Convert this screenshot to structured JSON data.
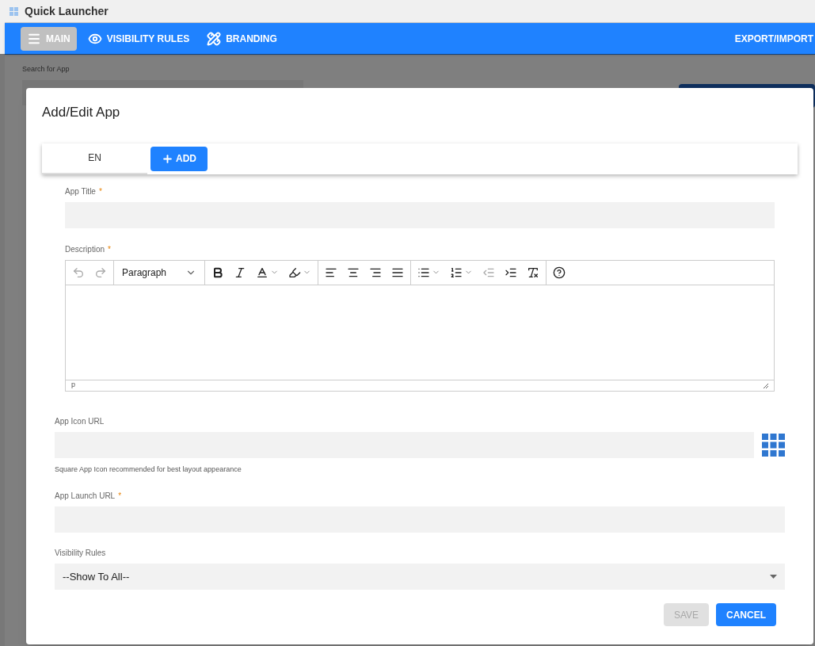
{
  "app": {
    "title": "Quick Launcher"
  },
  "nav": {
    "items": [
      {
        "label": "MAIN",
        "kind": "menu",
        "selected": true
      },
      {
        "label": "VISIBILITY RULES",
        "kind": "eye",
        "selected": false
      },
      {
        "label": "BRANDING",
        "kind": "tools",
        "selected": false
      }
    ],
    "right_label": "EXPORT/IMPORT"
  },
  "background": {
    "search_label": "Search for App"
  },
  "dialog": {
    "title": "Add/Edit App",
    "language_tabs": [
      {
        "label": "EN",
        "selected": true
      }
    ],
    "add_button": "ADD",
    "app_title": {
      "label": "App Title",
      "required_mark": "*"
    },
    "description": {
      "label": "Description",
      "required_mark": "*",
      "format": "Paragraph",
      "status": "p",
      "toolbar": [
        [
          {
            "kind": "undo",
            "disabled": true
          },
          {
            "kind": "redo",
            "disabled": true
          }
        ],
        [
          {
            "kind": "format"
          }
        ],
        [
          {
            "kind": "bold",
            "disabled": false
          },
          {
            "kind": "italic",
            "disabled": false
          },
          {
            "kind": "text-color",
            "disabled": false
          },
          {
            "kind": "highlight",
            "disabled": false
          }
        ],
        [
          {
            "kind": "align-left",
            "disabled": false
          },
          {
            "kind": "align-center",
            "disabled": false
          },
          {
            "kind": "align-right",
            "disabled": false
          },
          {
            "kind": "justify",
            "disabled": false
          }
        ],
        [
          {
            "kind": "bullets",
            "disabled": false
          },
          {
            "kind": "numbers",
            "disabled": false
          },
          {
            "kind": "outdent",
            "disabled": true
          },
          {
            "kind": "indent",
            "disabled": false
          },
          {
            "kind": "clear-format",
            "disabled": false
          }
        ],
        [
          {
            "kind": "help",
            "disabled": false
          }
        ]
      ]
    },
    "icon_url": {
      "label": "App Icon URL",
      "hint": "Square App Icon recommended for best layout appearance"
    },
    "launch_url": {
      "label": "App Launch URL",
      "required_mark": "*"
    },
    "visibility": {
      "label": "Visibility Rules",
      "value": "--Show To All--"
    },
    "buttons": [
      {
        "label": "SAVE",
        "disabled": true
      },
      {
        "label": "CANCEL",
        "disabled": false
      }
    ]
  }
}
